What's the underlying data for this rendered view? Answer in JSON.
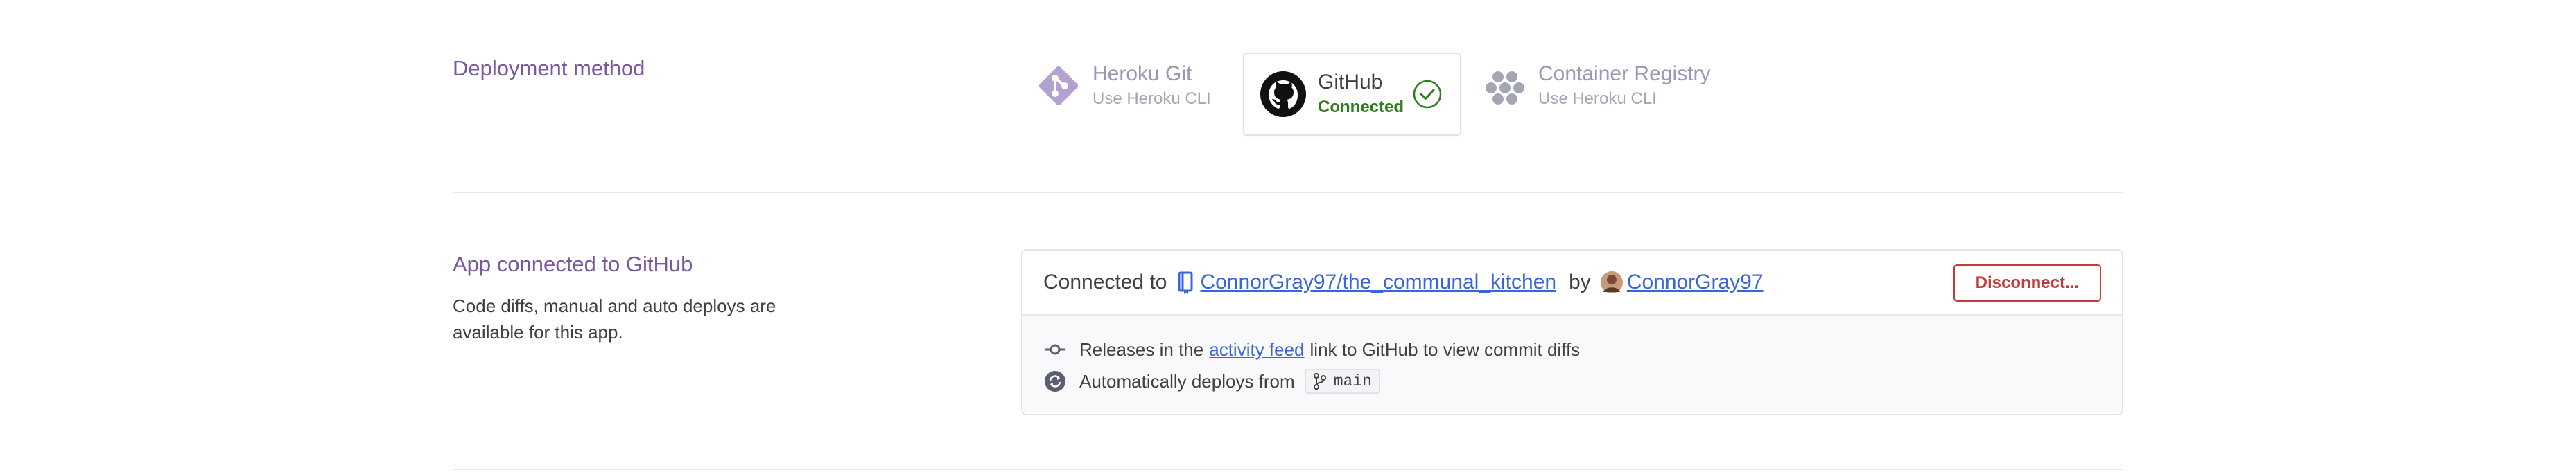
{
  "deployment_method": {
    "section_title": "Deployment method",
    "options": [
      {
        "name": "Heroku Git",
        "sub": "Use Heroku CLI",
        "icon": "heroku-git-icon"
      },
      {
        "name": "GitHub",
        "sub": "Connected",
        "icon": "github-icon",
        "selected": true
      },
      {
        "name": "Container Registry",
        "sub": "Use Heroku CLI",
        "icon": "container-registry-icon"
      }
    ]
  },
  "app_connected": {
    "section_title": "App connected to GitHub",
    "description": "Code diffs, manual and auto deploys are available for this app.",
    "connected_to_label": "Connected to",
    "repo": "ConnorGray97/the_communal_kitchen",
    "by_label": "by",
    "user": "ConnorGray97",
    "disconnect_label": "Disconnect...",
    "releases_prefix": "Releases in the",
    "activity_feed_link": "activity feed",
    "releases_suffix": "link to GitHub to view commit diffs",
    "auto_deploy_label": "Automatically deploys from",
    "branch": "main"
  },
  "colors": {
    "heading_purple": "#79589f",
    "connected_green": "#2e7d1f",
    "link_blue": "#3a64dc",
    "danger_red": "#c23b3b"
  }
}
